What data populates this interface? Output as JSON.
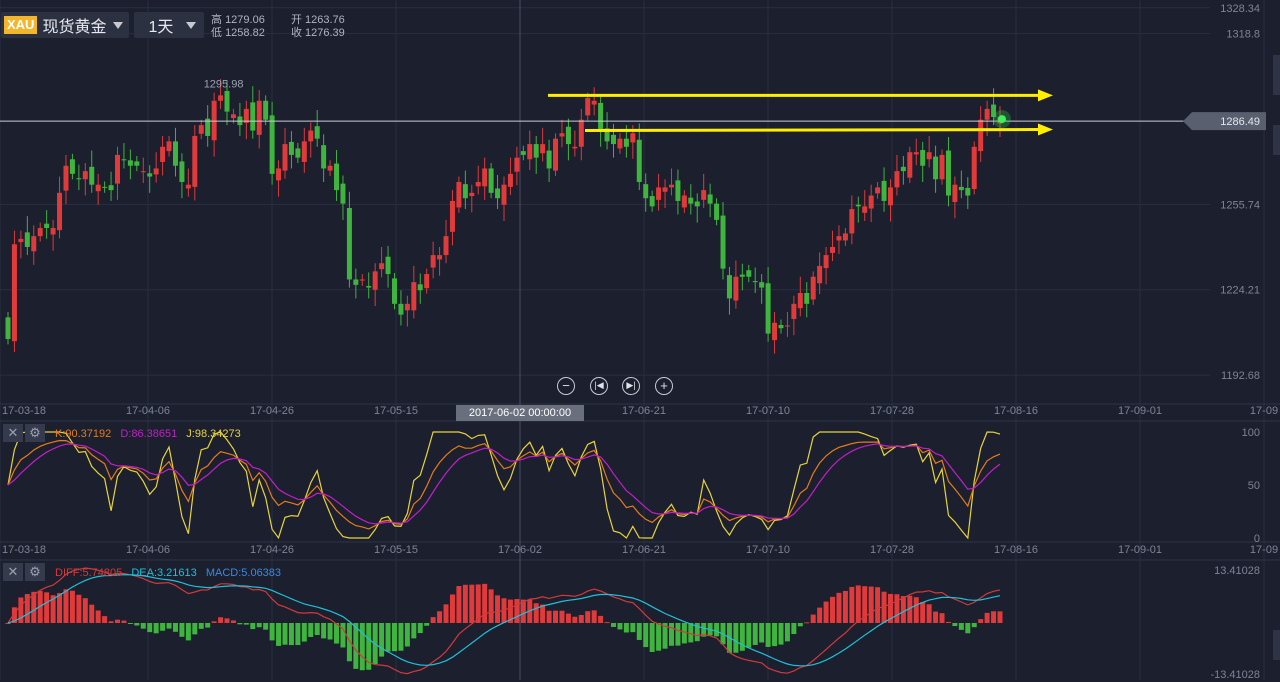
{
  "toolbar": {
    "symbol_code": "XAU",
    "symbol_name": "现货黄金",
    "period": "1天"
  },
  "ohlc": {
    "high_label": "高",
    "high": "1279.06",
    "open_label": "开",
    "open": "1263.76",
    "low_label": "低",
    "low": "1258.82",
    "close_label": "收",
    "close": "1276.39"
  },
  "colors": {
    "background": "#1b1f2e",
    "grid": "#2a2f40",
    "up_candle": "#e03a3a",
    "down_candle": "#3fb43f",
    "arrow": "#ffee00",
    "k_line": "#e57c1a",
    "d_line": "#c020c8",
    "j_line": "#e8d43a",
    "diff_line": "#d23a3a",
    "dea_line": "#20c0d8"
  },
  "chart_data": [
    {
      "type": "candlestick",
      "symbol": "XAU",
      "period": "1天",
      "y_ticks": [
        "1328.34",
        "1318.8",
        "1286.49",
        "1255.74",
        "1224.21",
        "1192.68"
      ],
      "x_ticks": [
        "17-03-18",
        "17-04-06",
        "17-04-26",
        "17-05-15",
        "17-06-02",
        "17-06-21",
        "17-07-10",
        "17-07-28",
        "17-08-16",
        "17-09-01",
        "17-09"
      ],
      "ylim": [
        1182,
        1329
      ],
      "current_price": "1286.49",
      "peak_annotation": "1295.98",
      "cursor_date": "2017-06-02 00:00:00",
      "closes": [
        1206,
        1241,
        1243,
        1240,
        1244,
        1247,
        1247,
        1247,
        1260,
        1270,
        1267,
        1265,
        1268,
        1263,
        1263,
        1262,
        1261,
        1274,
        1272,
        1270,
        1270,
        1268,
        1266,
        1269,
        1277,
        1279,
        1270,
        1264,
        1263,
        1281,
        1285,
        1281,
        1294,
        1296,
        1290,
        1289,
        1285,
        1291,
        1283,
        1294,
        1287,
        1267,
        1269,
        1278,
        1274,
        1273,
        1279,
        1283,
        1280,
        1269,
        1270,
        1261,
        1256,
        1228,
        1226,
        1228,
        1225,
        1231,
        1234,
        1230,
        1219,
        1215,
        1219,
        1227,
        1224,
        1230,
        1237,
        1237,
        1244,
        1257,
        1264,
        1258,
        1260,
        1264,
        1269,
        1260,
        1258,
        1263,
        1267,
        1273,
        1274,
        1278,
        1273,
        1278,
        1269,
        1280,
        1282,
        1278,
        1277,
        1287,
        1295,
        1294,
        1283,
        1279,
        1278,
        1280,
        1277,
        1282,
        1264,
        1258,
        1255,
        1262,
        1262,
        1263,
        1257,
        1259,
        1256,
        1255,
        1261,
        1256,
        1250,
        1232,
        1221,
        1229,
        1229,
        1229,
        1227,
        1225,
        1208,
        1212,
        1210,
        1211,
        1219,
        1223,
        1219,
        1229,
        1233,
        1237,
        1240,
        1244,
        1245,
        1254,
        1255,
        1255,
        1259,
        1262,
        1257,
        1262,
        1268,
        1268,
        1275,
        1275,
        1270,
        1275,
        1265,
        1274,
        1259,
        1263,
        1261,
        1259,
        1277,
        1287,
        1291,
        1288,
        1288
      ],
      "volumes_note": "none",
      "annotations": [
        {
          "kind": "arrow",
          "from_price": 1295.98
        },
        {
          "kind": "arrow",
          "from_price": 1283
        }
      ]
    },
    {
      "type": "line",
      "indicator": "KDJ",
      "series": [
        {
          "name": "K",
          "label": "K:90.37192"
        },
        {
          "name": "D",
          "label": "D:86.38651"
        },
        {
          "name": "J",
          "label": "J:98.34273"
        }
      ],
      "y_ticks": [
        "100",
        "50",
        "0"
      ],
      "ylim": [
        0,
        100
      ]
    },
    {
      "type": "bar",
      "indicator": "MACD",
      "series": [
        {
          "name": "DIFF",
          "label": "DIFF:5.74805"
        },
        {
          "name": "DEA",
          "label": "DEA:3.21613"
        },
        {
          "name": "MACD",
          "label": "MACD:5.06383"
        }
      ],
      "y_ticks": [
        "13.41028",
        "-13.41028"
      ],
      "ylim": [
        -13.41028,
        13.41028
      ]
    }
  ]
}
